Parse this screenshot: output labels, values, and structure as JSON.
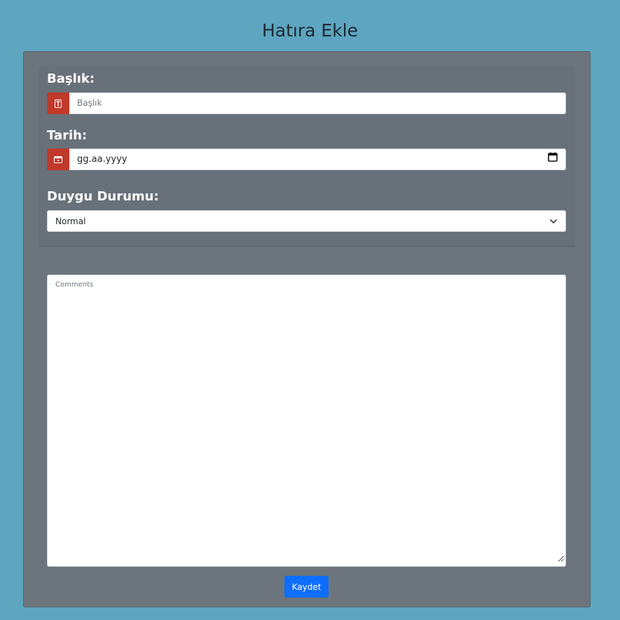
{
  "page": {
    "title": "Hatıra Ekle"
  },
  "form": {
    "title_label": "Başlık:",
    "title_placeholder": "Başlık",
    "date_label": "Tarih:",
    "date_value": "gg.aa.yyyy",
    "mood_label": "Duygu Durumu:",
    "mood_selected": "Normal",
    "comments_placeholder": "Comments",
    "save_label": "Kaydet"
  },
  "icons": {
    "title_addon": "text-icon",
    "date_addon": "calendar-icon",
    "date_picker": "calendar-picker-icon",
    "select": "chevron-down-icon"
  },
  "colors": {
    "background": "#5ea5bf",
    "card": "#6c757d",
    "addon": "#c0392b",
    "primary_button": "#0d6efd"
  }
}
